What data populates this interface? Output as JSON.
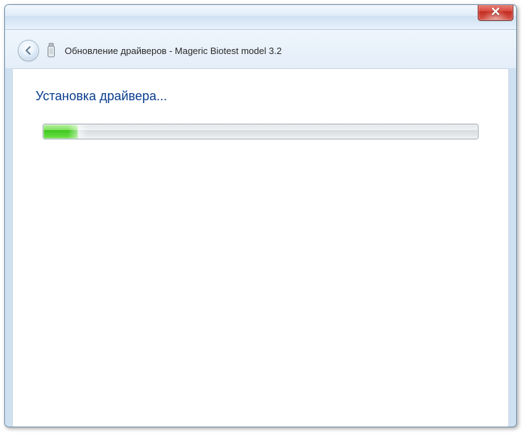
{
  "window": {
    "title": "Обновление драйверов - Mageric Biotest model 3.2"
  },
  "content": {
    "heading": "Установка драйвера..."
  },
  "progress": {
    "percent": 8
  },
  "icons": {
    "close": "close-icon",
    "back": "back-arrow-icon",
    "device": "device-icon"
  }
}
